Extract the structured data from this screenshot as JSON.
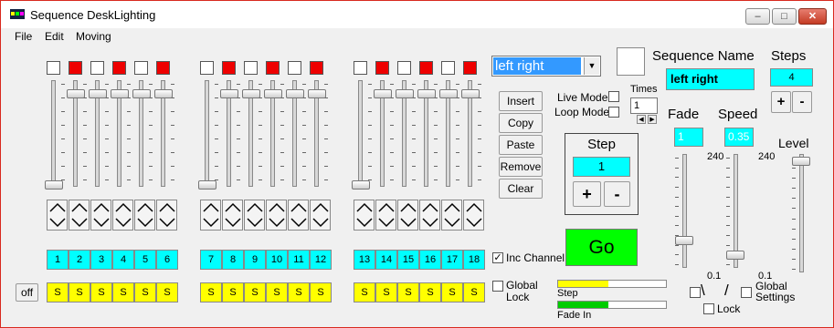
{
  "window": {
    "title": "Sequence DeskLighting",
    "min": "–",
    "max": "□",
    "close": "✕"
  },
  "menu": [
    "File",
    "Edit",
    "Moving"
  ],
  "channels": {
    "numbers": [
      "1",
      "2",
      "3",
      "4",
      "5",
      "6",
      "7",
      "8",
      "9",
      "10",
      "11",
      "12",
      "13",
      "14",
      "15",
      "16",
      "17",
      "18"
    ],
    "s_label": "S"
  },
  "off_button": "off",
  "sequence_select": {
    "value": "left right"
  },
  "buttons": {
    "insert": "Insert",
    "copy": "Copy",
    "paste": "Paste",
    "remove": "Remove",
    "clear": "Clear"
  },
  "live_mode": "Live Mode",
  "loop_mode": "Loop Mode",
  "times": {
    "label": "Times",
    "value": "1"
  },
  "step": {
    "title": "Step",
    "value": "1",
    "plus": "+",
    "minus": "-"
  },
  "go": "Go",
  "inc_channel": "Inc Channel",
  "global_lock": "Global Lock",
  "progress": {
    "step_label": "Step",
    "fade_label": "Fade In",
    "step_fill": 0.47,
    "fade_fill": 0.47,
    "step_color": "#ffff00",
    "fade_color": "#00cc00"
  },
  "sequence_name": {
    "label": "Sequence Name",
    "value": "left right"
  },
  "steps": {
    "label": "Steps",
    "value": "4",
    "plus": "+",
    "minus": "-"
  },
  "fade": {
    "label": "Fade",
    "value": "1"
  },
  "speed": {
    "label": "Speed",
    "value": "0.35"
  },
  "level": {
    "label": "Level"
  },
  "slider_max": "240",
  "slider_min": "0.1",
  "curve_left": "\\",
  "curve_right": "/",
  "lock": "Lock",
  "global_settings": "Global Settings",
  "colors": {
    "cyan": "#00ffff",
    "yellow": "#ffff00",
    "red": "#ee0000",
    "go_green": "#00ff00"
  }
}
